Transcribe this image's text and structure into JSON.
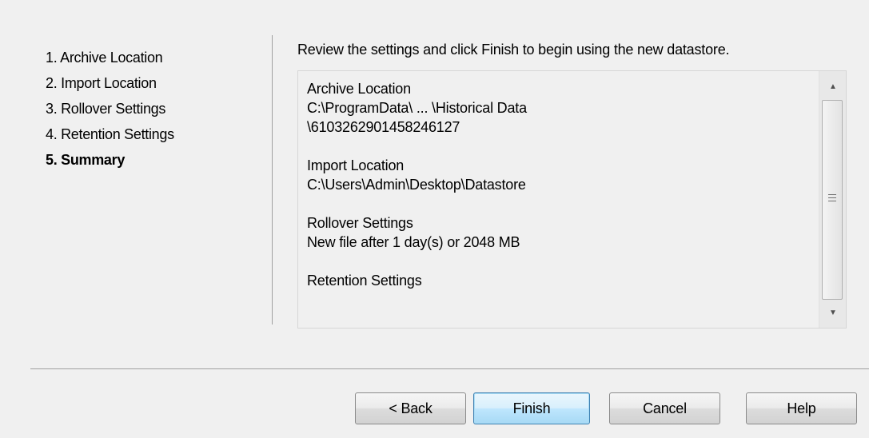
{
  "wizard": {
    "steps": [
      {
        "label": "1. Archive Location",
        "active": false
      },
      {
        "label": "2. Import Location",
        "active": false
      },
      {
        "label": "3. Rollover Settings",
        "active": false
      },
      {
        "label": "4. Retention Settings",
        "active": false
      },
      {
        "label": "5. Summary",
        "active": true
      }
    ],
    "instruction": "Review the settings and click Finish to begin using the new datastore.",
    "summary": {
      "archive_location": {
        "heading": "Archive Location",
        "lines": [
          "C:\\ProgramData\\ ... \\Historical Data",
          "\\6103262901458246127"
        ]
      },
      "import_location": {
        "heading": "Import Location",
        "lines": [
          "C:\\Users\\Admin\\Desktop\\Datastore"
        ]
      },
      "rollover_settings": {
        "heading": "Rollover Settings",
        "lines": [
          "New file after 1 day(s) or 2048 MB"
        ]
      },
      "retention_settings": {
        "heading": "Retention Settings"
      }
    },
    "scrollbar": {
      "up_icon": "scroll-up-arrow",
      "down_icon": "scroll-down-arrow",
      "grip_icon": "grip-lines"
    },
    "buttons": {
      "back": "< Back",
      "finish": "Finish",
      "cancel": "Cancel",
      "help": "Help"
    }
  }
}
